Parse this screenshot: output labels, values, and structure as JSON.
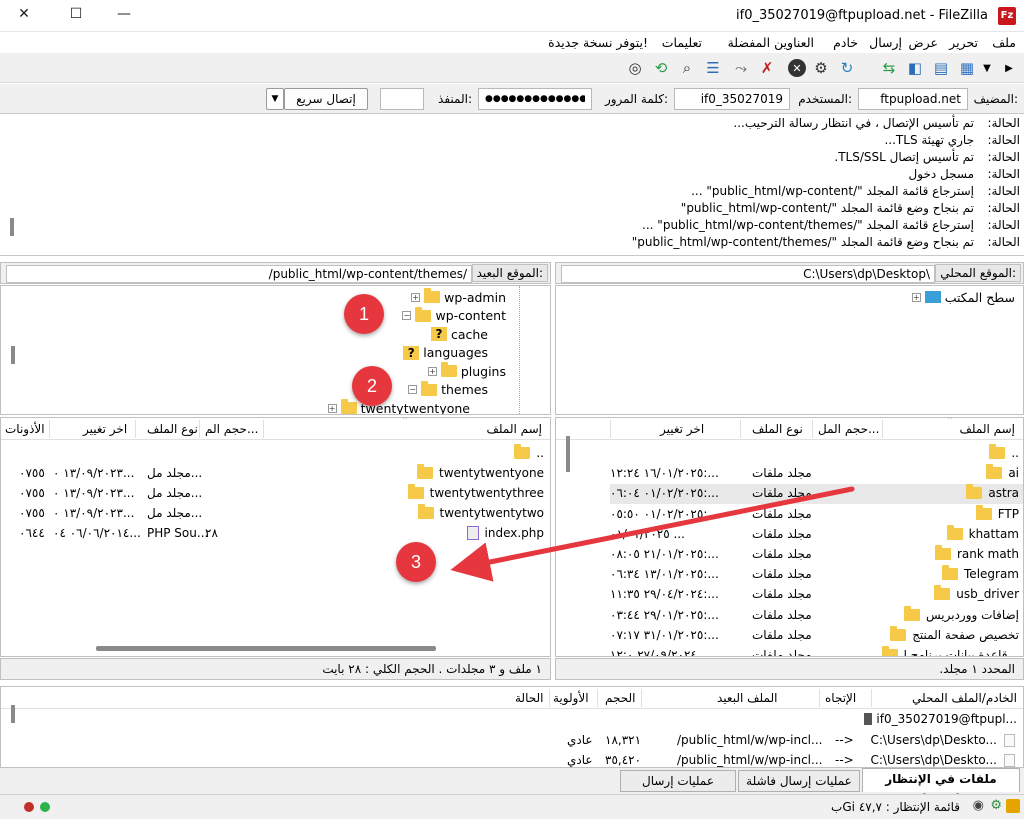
{
  "window": {
    "title": "if0_35027019@ftpupload.net - FileZilla",
    "logo_text": "Fz"
  },
  "menu": {
    "items": [
      "ملف",
      "تحرير",
      "عرض",
      "إرسال",
      "خادم",
      "العناوين المفضلة",
      "تعليمات",
      "يتوفر نسخة جديدة!"
    ]
  },
  "quickconnect": {
    "host_label": "المضيف:",
    "host_value": "ftpupload.net",
    "user_label": "المستخدم:",
    "user_value": "if0_35027019",
    "pass_label": "كلمة المرور:",
    "pass_value": "●●●●●●●●●●●●●●",
    "port_label": "المنفذ:",
    "port_value": "",
    "connect_label": "إتصال سريع"
  },
  "log": {
    "label": "الحالة:",
    "lines": [
      "تم تأسيس الإتصال ، في انتظار رسالة الترحيب...",
      "جاري تهيئة TLS...",
      "تم تأسيس إتصال TLS/SSL.",
      "مسجل دخول",
      "إسترجاع قائمة المجلد \"/public_html/wp-content\" ...",
      "تم بنجاح وضع قائمة المجلد \"/public_html/wp-content\"",
      "إسترجاع قائمة المجلد \"/public_html/wp-content/themes\" ...",
      "تم بنجاح وضع قائمة المجلد \"/public_html/wp-content/themes\""
    ]
  },
  "local": {
    "path_label": "الموقع المحلي:",
    "path_value": "C:\\Users\\dp\\Desktop\\",
    "tree_root": "سطح المكتب",
    "headers": [
      "إسم الملف",
      "حجم المل...",
      "نوع الملف",
      "اخر تغيير"
    ],
    "rows": [
      {
        "name": "..",
        "size": "",
        "type": "",
        "date": ""
      },
      {
        "name": "ai",
        "size": "",
        "type": "مجلد ملفات",
        "date": "١٦/٠١/٢٠٢٥ ١٢:٢٤:..."
      },
      {
        "name": "astra",
        "size": "",
        "type": "مجلد ملفات",
        "date": "٠١/٠٢/٢٠٢٥ ٠٦:٠٤:..."
      },
      {
        "name": "FTP",
        "size": "",
        "type": "مجلد ملفات",
        "date": "٠١/٠٢/٢٠٢٥ ٠٥:٥٠:..."
      },
      {
        "name": "khattam",
        "size": "",
        "type": "مجلد ملفات",
        "date": "٠١/٠١/٢٠٢٥ ..."
      },
      {
        "name": "rank math",
        "size": "",
        "type": "مجلد ملفات",
        "date": "٢١/٠١/٢٠٢٥ ٠٨:٠٥:..."
      },
      {
        "name": "Telegram",
        "size": "",
        "type": "مجلد ملفات",
        "date": "١٣/٠١/٢٠٢٥ ٠٦:٣٤:..."
      },
      {
        "name": "usb_driver",
        "size": "",
        "type": "مجلد ملفات",
        "date": "٢٩/٠٤/٢٠٢٤ ١١:٣٥:..."
      },
      {
        "name": "إضافات ووردبريس",
        "size": "",
        "type": "مجلد ملفات",
        "date": "٢٩/٠١/٢٠٢٥ ٠٣:٤٤:..."
      },
      {
        "name": "تخصيص صفحة المنتج",
        "size": "",
        "type": "مجلد ملفات",
        "date": "٣١/٠١/٢٠٢٥ ٠٧:١٧:..."
      },
      {
        "name": "قاعدة بيانات برنامج ا...",
        "size": "",
        "type": "مجلد ملفات",
        "date": "٢٧/٠٩/٢٠٢٤ ١٢:٠..."
      }
    ],
    "status": "المحدد ١ مجلد."
  },
  "remote": {
    "path_label": "الموقع البعيد:",
    "path_value": "/public_html/wp-content/themes/",
    "tree": [
      {
        "name": "wp-admin",
        "kind": "folder",
        "exp": "+"
      },
      {
        "name": "wp-content",
        "kind": "folder",
        "exp": "−"
      },
      {
        "name": "cache",
        "kind": "q",
        "exp": ""
      },
      {
        "name": "languages",
        "kind": "q",
        "exp": ""
      },
      {
        "name": "plugins",
        "kind": "folder",
        "exp": "+"
      },
      {
        "name": "themes",
        "kind": "folder",
        "exp": "−"
      },
      {
        "name": "twentytwentyone",
        "kind": "folder",
        "exp": "+"
      }
    ],
    "headers": [
      "إسم الملف",
      "حجم الم...",
      "نوع الملف",
      "اخر تغيير",
      "الأذونات"
    ],
    "rows": [
      {
        "name": "..",
        "size": "",
        "type": "",
        "date": "",
        "perm": ""
      },
      {
        "name": "twentytwentyone",
        "size": "",
        "type": "مجلد مل...",
        "date": "١٣/٠٩/٢٠٢٣ ٠...",
        "perm": "٠٧٥٥"
      },
      {
        "name": "twentytwentythree",
        "size": "",
        "type": "مجلد مل...",
        "date": "١٣/٠٩/٢٠٢٣ ٠...",
        "perm": "٠٧٥٥"
      },
      {
        "name": "twentytwentytwo",
        "size": "",
        "type": "مجلد مل...",
        "date": "١٣/٠٩/٢٠٢٣ ٠...",
        "perm": "٠٧٥٥"
      },
      {
        "name": "index.php",
        "size": "٢٨",
        "type": "PHP Sou...",
        "date": "٠٦/٠٦/٢٠١٤ ٠٤...",
        "perm": "٠٦٤٤"
      }
    ],
    "status": "١ ملف و ٣ مجلدات . الحجم الكلي : ٢٨ بايت"
  },
  "queue": {
    "headers": [
      "الخادم/الملف المحلي",
      "الإتجاه",
      "الملف البعيد",
      "الحجم",
      "الأولوية",
      "الحالة"
    ],
    "server": "if0_35027019@ftpupl...",
    "rows": [
      {
        "local": "C:\\Users\\dp\\Deskto...",
        "dir": "-->",
        "remote": "/public_html/w/wp-incl...",
        "size": "١٨,٣٢١",
        "prio": "عادي"
      },
      {
        "local": "C:\\Users\\dp\\Deskto...",
        "dir": "-->",
        "remote": "/public_html/w/wp-incl...",
        "size": "٣٥,٤٢٠",
        "prio": "عادي"
      }
    ]
  },
  "tabs": {
    "queued": "ملفات في الإنتظار (١٤٦٠)",
    "failed": "عمليات إرسال فاشلة",
    "success": "عمليات إرسال ناجحة"
  },
  "bottom": {
    "queue_text": "قائمة الإنتظار : ٤٧,٧ Giب"
  },
  "callouts": {
    "one": "1",
    "two": "2",
    "three": "3"
  },
  "colors": {
    "callout": "#e5373d",
    "folder": "#f7c948",
    "selection": "#e8e8e8"
  }
}
